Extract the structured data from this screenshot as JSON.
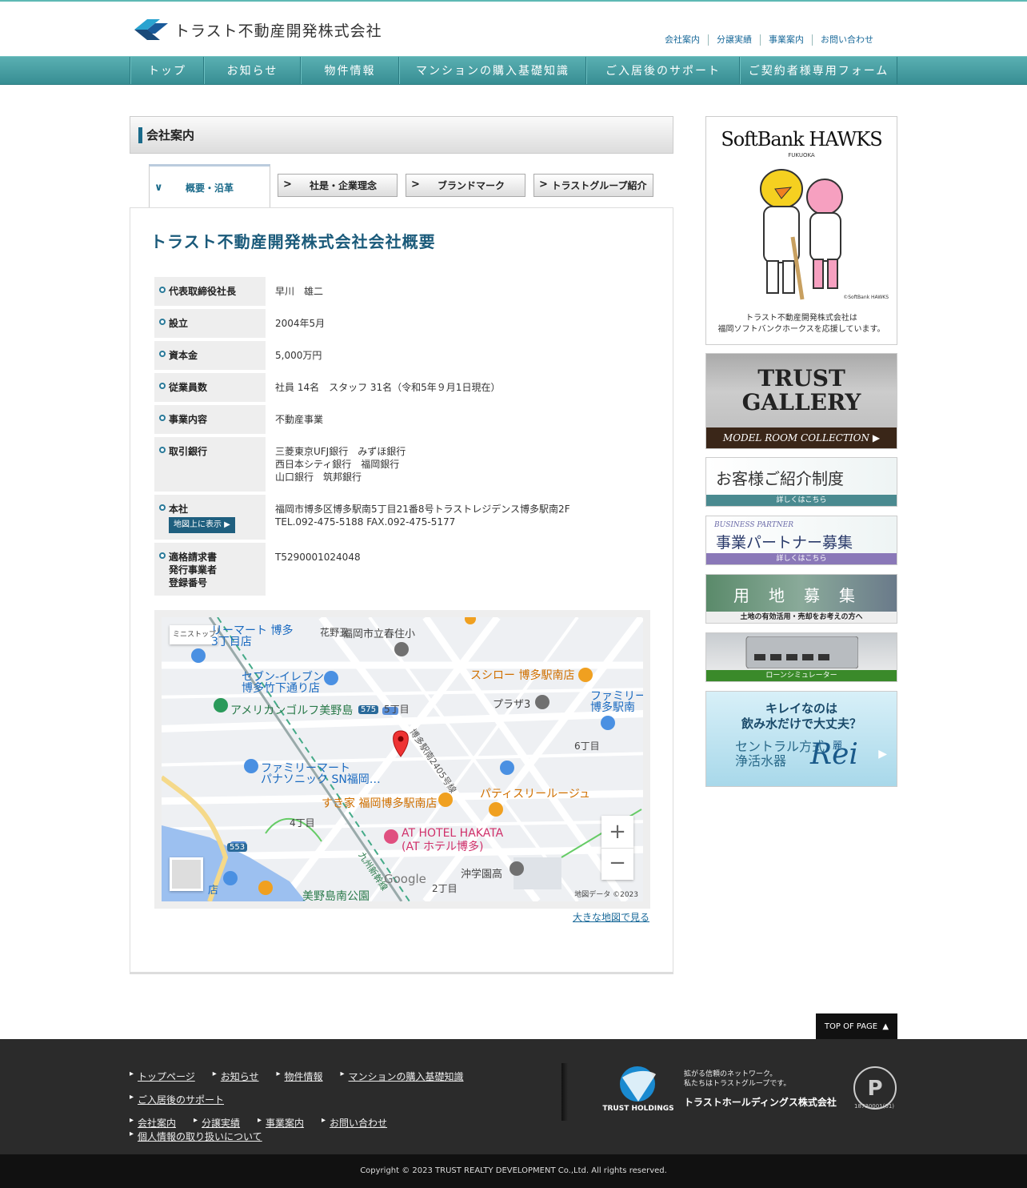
{
  "header": {
    "company_name": "トラスト不動産開発株式会社",
    "util_nav": [
      "会社案内",
      "分譲実績",
      "事業案内",
      "お問い合わせ"
    ]
  },
  "global_nav": [
    {
      "label": "トップ",
      "w": 92
    },
    {
      "label": "お知らせ",
      "w": 121
    },
    {
      "label": "物件情報",
      "w": 123
    },
    {
      "label": "マンションの購入基礎知識",
      "w": 234
    },
    {
      "label": "ご入居後のサポート",
      "w": 192
    },
    {
      "label": "ご契約者様専用フォーム",
      "w": 197
    }
  ],
  "page": {
    "heading": "会社案内",
    "tabs": {
      "active": "概要・沿革",
      "others": [
        "社是・企業理念",
        "ブランドマーク",
        "トラストグループ紹介"
      ]
    },
    "company_title": "トラスト不動産開発株式会社会社概要",
    "rows": [
      {
        "label": "代表取締役社長",
        "value": "早川　雄二"
      },
      {
        "label": "設立",
        "value": "2004年5月"
      },
      {
        "label": "資本金",
        "value": "5,000万円"
      },
      {
        "label": "従業員数",
        "value": "社員 14名　スタッフ 31名（令和5年９月1日現在）"
      },
      {
        "label": "事業内容",
        "value": "不動産事業"
      },
      {
        "label": "取引銀行",
        "value": "三菱東京UFJ銀行　みずほ銀行\n西日本シティ銀行　福岡銀行\n山口銀行　筑邦銀行"
      },
      {
        "label": "本社",
        "value": "福岡市博多区博多駅南5丁目21番8号トラストレジデンス博多駅南2F\nTEL.092-475-5188 FAX.092-475-5177",
        "button": "地図上に表示"
      },
      {
        "label": "適格請求書\n発行事業者\n登録番号",
        "value": "T5290001024048"
      }
    ],
    "map": {
      "labels": [
        "ミニストップ",
        "リーマート 博多",
        "3丁目店",
        "福岡市立春住小",
        "花野丑",
        "セブン-イレブン",
        "博多竹下通り店",
        "スシロー 博多駅南店",
        "ファミリー",
        "博多駅南",
        "アメリカンゴルフ美野島",
        "575",
        "5丁目",
        "プラザ3",
        "博多駅南2405号線",
        "6丁目",
        "ファミリーマート",
        "パナソニック SN福岡…",
        "すき家 福岡博多駅南店",
        "パティスリールージュ",
        "4丁目",
        "AT HOTEL HAKATA",
        "(AT ホテル博多)",
        "553",
        "九州新幹線",
        "沖学園高",
        "2丁目",
        "美野島南公園",
        "店",
        "Google"
      ],
      "attribution": "地図データ ©2023",
      "link": "大きな地図で見る"
    }
  },
  "sidebar": {
    "hawks": {
      "title": "SoftBank HAWKS",
      "sub": "FUKUOKA",
      "caption": "トラスト不動産開発株式会社は\n福岡ソフトバンクホークスを応援しています。",
      "credit": "©SoftBank HAWKS"
    },
    "gallery": {
      "title": "TRUST\nGALLERY",
      "bar": "MODEL ROOM COLLECTION"
    },
    "referral": {
      "title": "お客様ご紹介制度",
      "bar": "詳しくはこちら"
    },
    "partner": {
      "sub": "BUSINESS PARTNER",
      "title": "事業パートナー募集",
      "bar": "詳しくはこちら"
    },
    "land": {
      "title": "用　地　募　集",
      "bar": "土地の有効活用・売却をお考えの方へ"
    },
    "loan": {
      "bar": "ローンシミュレーター"
    },
    "rei": {
      "title": "キレイなのは\n飲み水だけで大丈夫？",
      "sub": "セントラル方式\n浄活水器",
      "brand": "Rei",
      "kanji": "麗"
    }
  },
  "top_of_page": "TOP OF PAGE",
  "footer": {
    "row1": [
      "トップページ",
      "お知らせ",
      "物件情報",
      "マンションの購入基礎知識"
    ],
    "row2": [
      "ご入居後のサポート"
    ],
    "row3": [
      "会社案内",
      "分譲実績",
      "事業案内",
      "お問い合わせ",
      "個人情報の取り扱いについて"
    ],
    "holdings_logo": "TRUST HOLDINGS",
    "tagline": "拡がる信頼のネットワーク。\n私たちはトラストグループです。",
    "holdings_name": "トラストホールディングス株式会社",
    "pmark": "18730001(01)",
    "copyright": "Copyright © 2023 TRUST REALTY DEVELOPMENT Co.,Ltd. All rights reserved."
  },
  "colors": {
    "teal": "#378e93",
    "accent": "#1a6a8a",
    "footer": "#2b2b2b"
  }
}
